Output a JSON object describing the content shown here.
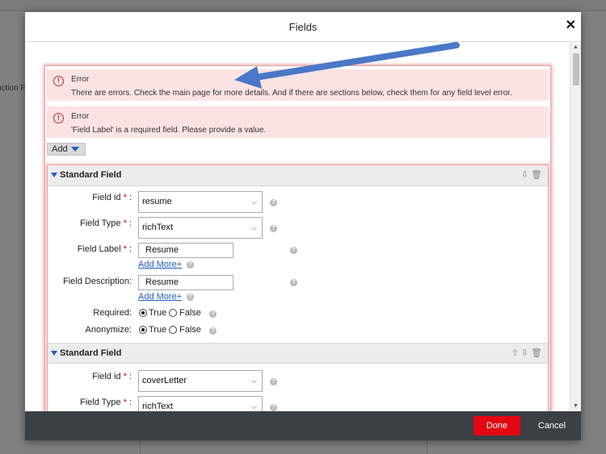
{
  "background": {
    "partial_text": "uction F"
  },
  "dialog": {
    "title": "Fields",
    "close_glyph": "✕"
  },
  "errors": [
    {
      "title": "Error",
      "message": "There are errors. Check the main page for more details. And if there are sections below, check them for any field level error."
    },
    {
      "title": "Error",
      "message": "'Field Label' is a required field. Please provide a value."
    }
  ],
  "add_button": {
    "label": "Add"
  },
  "sections": [
    {
      "title": "Standard Field",
      "field_id": {
        "label": "Field id",
        "value": "resume"
      },
      "field_type": {
        "label": "Field Type",
        "value": "richText"
      },
      "field_label": {
        "label": "Field Label",
        "value": "Resume",
        "add_more": "Add More+"
      },
      "field_description": {
        "label": "Field Description:",
        "value": "Resume",
        "add_more": "Add More+"
      },
      "required": {
        "label": "Required:",
        "true_label": "True",
        "false_label": "False"
      },
      "anonymize": {
        "label": "Anonymize:",
        "true_label": "True",
        "false_label": "False"
      }
    },
    {
      "title": "Standard Field",
      "field_id": {
        "label": "Field id",
        "value": "coverLetter"
      },
      "field_type": {
        "label": "Field Type",
        "value": "richText"
      }
    }
  ],
  "footer": {
    "done_label": "Done",
    "cancel_label": "Cancel"
  },
  "colors": {
    "done_button": "#e30613",
    "footer_bg": "#3b4045",
    "error_bg": "#fbe3e4",
    "link": "#1f5bc2",
    "arrow": "#4a78c8"
  },
  "icons": [
    "alert-circle-icon",
    "caret-down-icon",
    "move-up-icon",
    "move-down-icon",
    "trash-icon",
    "help-icon",
    "close-icon",
    "annotation-arrow"
  ]
}
